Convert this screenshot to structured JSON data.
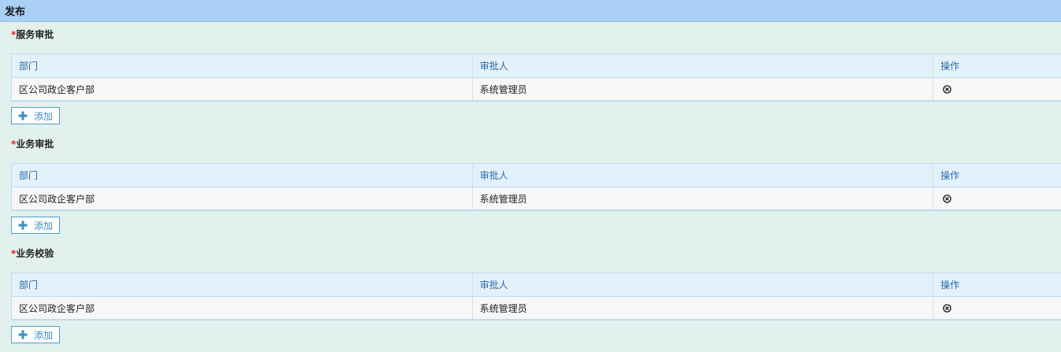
{
  "header": {
    "title": "发布"
  },
  "columns": {
    "dept": "部门",
    "approver": "审批人",
    "action": "操作"
  },
  "sections": [
    {
      "required_mark": "*",
      "title": "服务审批",
      "rows": [
        {
          "dept": "区公司政企客户部",
          "approver": "系统管理员"
        }
      ],
      "add_label": "添加"
    },
    {
      "required_mark": "*",
      "title": "业务审批",
      "rows": [
        {
          "dept": "区公司政企客户部",
          "approver": "系统管理员"
        }
      ],
      "add_label": "添加"
    },
    {
      "required_mark": "*",
      "title": "业务校验",
      "rows": [
        {
          "dept": "区公司政企客户部",
          "approver": "系统管理员"
        }
      ],
      "add_label": "添加"
    }
  ],
  "icons": {
    "delete": "circle-x-icon",
    "add": "plus-icon"
  },
  "colors": {
    "header_bg": "#aad1f5",
    "page_bg": "#e2f1ee",
    "grid_header_bg": "#e3f1fb",
    "required": "#e02020",
    "link": "#3a8fc4"
  }
}
